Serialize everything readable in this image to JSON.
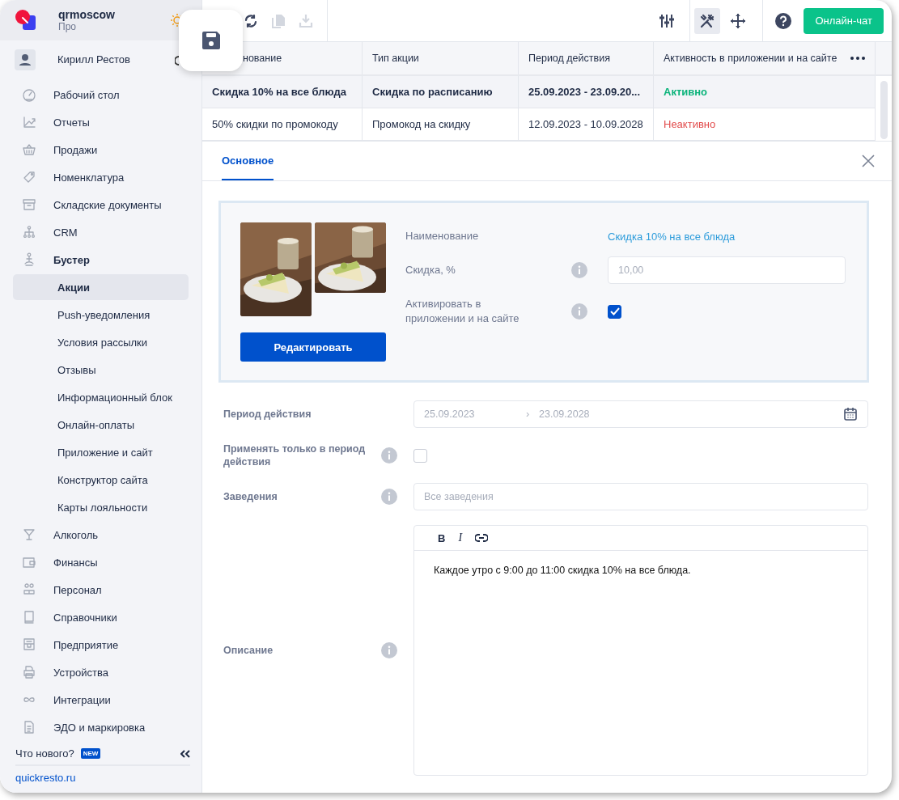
{
  "sidebar": {
    "account": {
      "name": "qrmoscow",
      "plan": "Про"
    },
    "user": {
      "name": "Кирилл Рестов"
    },
    "items": [
      {
        "label": "Рабочий стол",
        "kind": "dashboard",
        "selected": false
      },
      {
        "label": "Отчеты",
        "kind": "reports",
        "selected": false
      },
      {
        "label": "Продажи",
        "kind": "sales",
        "selected": false
      },
      {
        "label": "Номенклатура",
        "kind": "nomenclature",
        "selected": false
      },
      {
        "label": "Складские документы",
        "kind": "warehouse",
        "selected": false
      },
      {
        "label": "CRM",
        "kind": "crm",
        "selected": false
      },
      {
        "label": "Бустер",
        "kind": "booster",
        "selected": false,
        "expanded": true,
        "children": [
          {
            "label": "Акции",
            "selected": true
          },
          {
            "label": "Push-уведомления",
            "selected": false
          },
          {
            "label": "Условия рассылки",
            "selected": false
          },
          {
            "label": "Отзывы",
            "selected": false
          },
          {
            "label": "Информационный блок",
            "selected": false
          },
          {
            "label": "Онлайн-оплаты",
            "selected": false
          },
          {
            "label": "Приложение и сайт",
            "selected": false
          },
          {
            "label": "Конструктор сайта",
            "selected": false
          },
          {
            "label": "Карты лояльности",
            "selected": false
          }
        ]
      },
      {
        "label": "Алкоголь",
        "kind": "alcohol",
        "selected": false
      },
      {
        "label": "Финансы",
        "kind": "finance",
        "selected": false
      },
      {
        "label": "Персонал",
        "kind": "staff",
        "selected": false
      },
      {
        "label": "Справочники",
        "kind": "reference",
        "selected": false
      },
      {
        "label": "Предприятие",
        "kind": "enterprise",
        "selected": false
      },
      {
        "label": "Устройства",
        "kind": "devices",
        "selected": false
      },
      {
        "label": "Интеграции",
        "kind": "integrations",
        "selected": false
      },
      {
        "label": "ЭДО и маркировка",
        "kind": "edo",
        "selected": false
      }
    ],
    "whats_new": "Что нового?",
    "new_badge": "NEW",
    "link": "quickresto.ru"
  },
  "toolbar": {
    "left": [
      {
        "kind": "refresh",
        "disabled": false
      },
      {
        "kind": "copy",
        "disabled": true
      },
      {
        "kind": "download",
        "disabled": true
      }
    ],
    "right": [
      {
        "kind": "columns",
        "selected": false
      },
      {
        "kind": "tools",
        "selected": true
      },
      {
        "kind": "move",
        "selected": false
      }
    ],
    "chat_button": "Онлайн-чат"
  },
  "table": {
    "columns": [
      {
        "label": "нование"
      },
      {
        "label": "Тип акции"
      },
      {
        "label": "Период действия"
      },
      {
        "label": "Активность в приложении и на сайте"
      }
    ],
    "rows": [
      {
        "selected": true,
        "cells": [
          "Скидка 10% на все блюда",
          "Скидка по расписанию",
          "25.09.2023 - 23.09.20..."
        ],
        "status": {
          "label": "Активно",
          "active": true
        }
      },
      {
        "selected": false,
        "cells": [
          "50% скидки по промокоду",
          "Промокод на скидку",
          "12.09.2023 - 10.09.2028"
        ],
        "status": {
          "label": "Неактивно",
          "active": false
        }
      }
    ]
  },
  "detail": {
    "tabs": [
      {
        "label": "Основное",
        "selected": true
      }
    ],
    "card": {
      "edit_button": "Редактировать",
      "name_label": "Наименование",
      "name_value": "Скидка 10% на все блюда",
      "discount_label": "Скидка, %",
      "discount_value": "10,00",
      "activate_label": "Активировать в приложении и на сайте",
      "activate_checked": true
    },
    "form": {
      "period": {
        "label": "Период действия",
        "from": "25.09.2023",
        "separator": "›",
        "to": "23.09.2028"
      },
      "only_period": {
        "label": "Применять только в период действия",
        "checked": false
      },
      "venues": {
        "label": "Заведения",
        "placeholder": "Все заведения"
      },
      "description": {
        "label": "Описание",
        "tools": [
          {
            "kind": "bold",
            "label": "B"
          },
          {
            "kind": "italic",
            "label": "I"
          },
          {
            "kind": "link"
          }
        ],
        "text": "Каждое утро с 9:00 до 11:00 скидка 10% на все блюда."
      }
    }
  }
}
